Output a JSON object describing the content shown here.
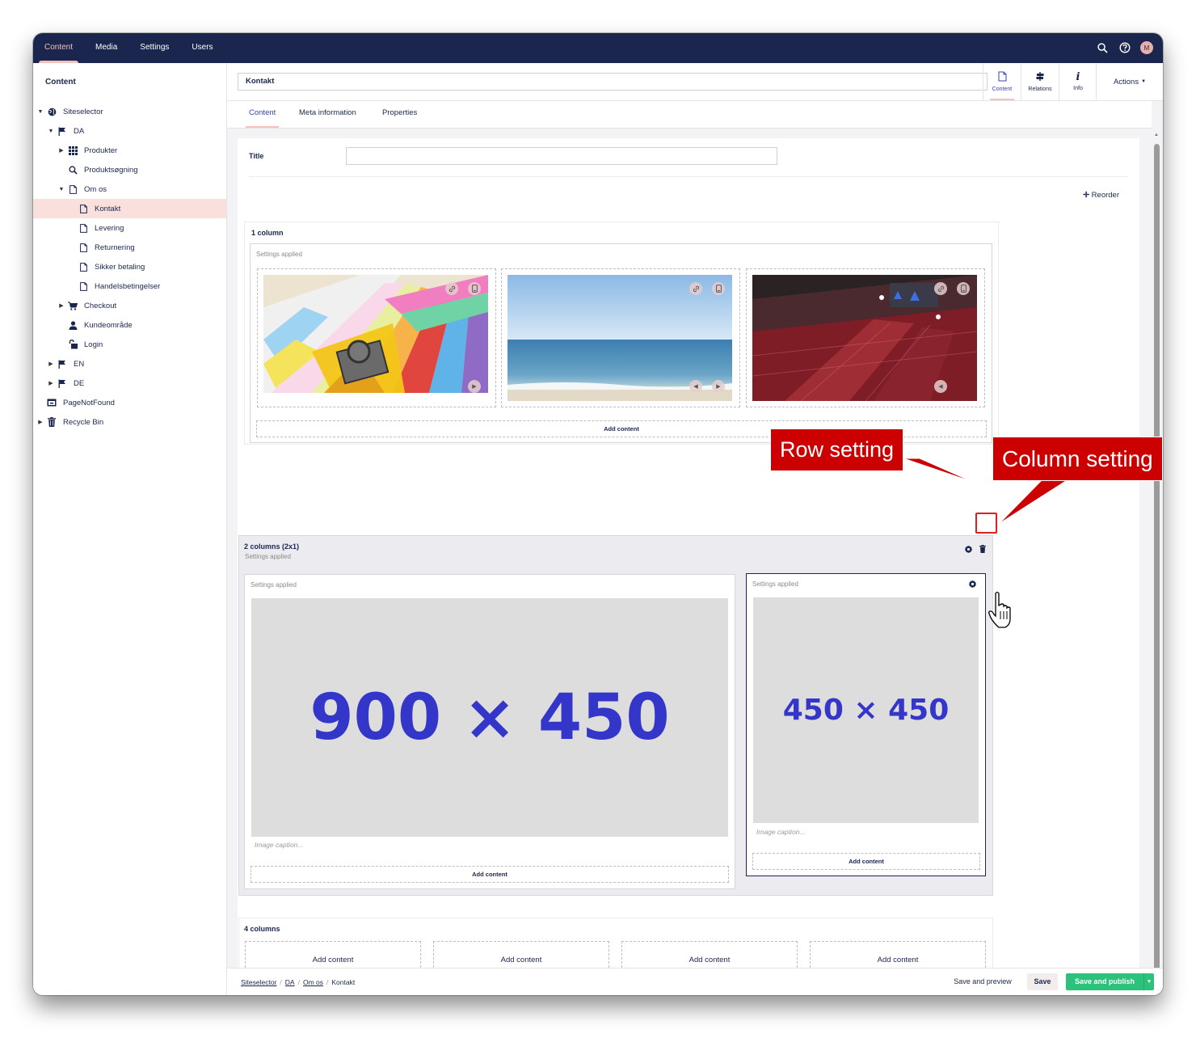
{
  "topnav": {
    "items": [
      "Content",
      "Media",
      "Settings",
      "Users"
    ],
    "active": "Content",
    "avatar_initial": "M"
  },
  "sidebar": {
    "title": "Content",
    "tree": [
      {
        "label": "Siteselector",
        "icon": "globe-icon",
        "level": 0,
        "caret": "down"
      },
      {
        "label": "DA",
        "icon": "flag-icon",
        "level": 1,
        "caret": "down"
      },
      {
        "label": "Produkter",
        "icon": "grid-icon",
        "level": 2,
        "caret": "right"
      },
      {
        "label": "Produktsøgning",
        "icon": "search-icon",
        "level": 2,
        "caret": ""
      },
      {
        "label": "Om os",
        "icon": "document-icon",
        "level": 2,
        "caret": "down"
      },
      {
        "label": "Kontakt",
        "icon": "document-icon",
        "level": 3,
        "caret": "",
        "selected": true
      },
      {
        "label": "Levering",
        "icon": "document-icon",
        "level": 3,
        "caret": ""
      },
      {
        "label": "Returnering",
        "icon": "document-icon",
        "level": 3,
        "caret": ""
      },
      {
        "label": "Sikker betaling",
        "icon": "document-icon",
        "level": 3,
        "caret": ""
      },
      {
        "label": "Handelsbetingelser",
        "icon": "document-icon",
        "level": 3,
        "caret": ""
      },
      {
        "label": "Checkout",
        "icon": "cart-icon",
        "level": 2,
        "caret": "right"
      },
      {
        "label": "Kundeområde",
        "icon": "user-icon",
        "level": 2,
        "caret": ""
      },
      {
        "label": "Login",
        "icon": "unlock-icon",
        "level": 2,
        "caret": ""
      },
      {
        "label": "EN",
        "icon": "flag-icon",
        "level": 1,
        "caret": "right"
      },
      {
        "label": "DE",
        "icon": "flag-icon",
        "level": 1,
        "caret": "right"
      },
      {
        "label": "PageNotFound",
        "icon": "window-icon",
        "level": 0,
        "caret": ""
      },
      {
        "label": "Recycle Bin",
        "icon": "trash-icon",
        "level": 0,
        "caret": "right"
      }
    ]
  },
  "editor": {
    "node_name": "Kontakt",
    "apps": [
      {
        "label": "Content",
        "icon": "document-icon"
      },
      {
        "label": "Relations",
        "icon": "signpost-icon"
      },
      {
        "label": "Info",
        "icon": "info-icon"
      }
    ],
    "actions_label": "Actions",
    "tabs": [
      "Content",
      "Meta information",
      "Properties"
    ]
  },
  "form": {
    "title_label": "Title",
    "title_value": "",
    "reorder_label": "Reorder"
  },
  "grid": {
    "settings_applied": "Settings applied",
    "add_content": "Add content",
    "image_caption_placeholder": "Image caption...",
    "row1": {
      "title": "1 column"
    },
    "row2": {
      "title": "2 columns (2x1)",
      "left_placeholder": "900 × 450",
      "right_placeholder": "450 × 450"
    },
    "row3": {
      "title": "4 columns"
    }
  },
  "footer": {
    "breadcrumbs": [
      "Siteselector",
      "DA",
      "Om os",
      "Kontakt"
    ],
    "save_preview": "Save and preview",
    "save": "Save",
    "save_publish": "Save and publish"
  },
  "callouts": {
    "row_setting": "Row setting",
    "column_setting": "Column setting"
  },
  "colors": {
    "header": "#1b264f",
    "accent": "#f5c1bc",
    "publish": "#2bc37c",
    "callout": "#cc0000"
  }
}
